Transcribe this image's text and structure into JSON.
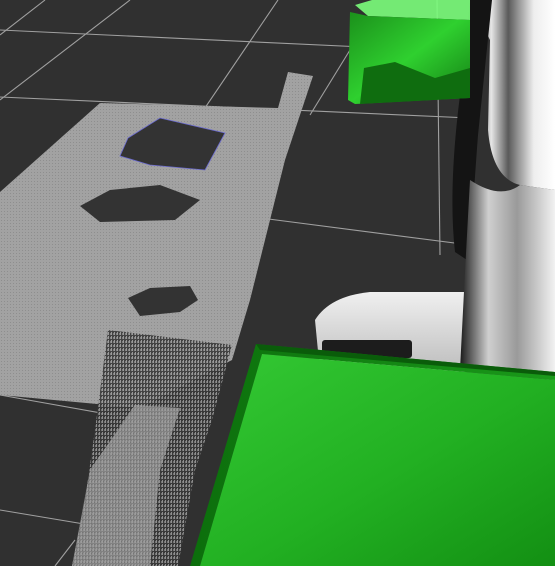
{
  "viewport": {
    "view": "3d-render",
    "background_color": "#303030",
    "grid_color": "#a0a0a0"
  },
  "scene": {
    "point_cloud": {
      "color": "#a4a4a4",
      "holes_color": "#333333",
      "hole_count": 3
    },
    "robot_body": {
      "color": "#d8d8d8",
      "shadow_color": "#1e1e1e"
    },
    "boxes": [
      {
        "color": "#21a821"
      },
      {
        "color": "#26b826"
      }
    ]
  }
}
